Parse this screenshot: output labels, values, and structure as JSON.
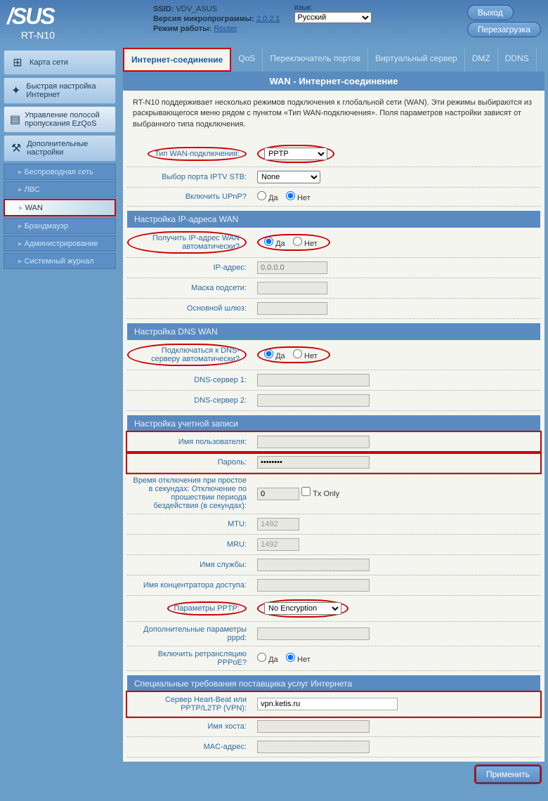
{
  "header": {
    "brand": "/SUS",
    "model": "RT-N10",
    "ssid_label": "SSID:",
    "ssid": "VDV_ASUS",
    "fw_label": "Версия микропрограммы:",
    "fw": "2.0.2.1",
    "mode_label": "Режим работы:",
    "mode": "Router",
    "lang_label": "язык:",
    "lang": "Русский",
    "logout": "Выход",
    "reboot": "Перезагрузка"
  },
  "sidebar": {
    "map": "Карта сети",
    "qis": "Быстрая настройка Интернет",
    "ezqos": "Управление полосой пропускания EzQoS",
    "adv": "Дополнительные настройки",
    "sub": [
      "Беспроводная сеть",
      "ЛВС",
      "WAN",
      "Брандмауэр",
      "Администрирование",
      "Системный журнал"
    ]
  },
  "tabs": [
    "Интернет-соединение",
    "QoS",
    "Переключатель портов",
    "Виртуальный сервер",
    "DMZ",
    "DDNS"
  ],
  "title": "WAN - Интернет-соединение",
  "desc": "RT-N10 поддерживает несколько режимов подключения к глобальной сети (WAN). Эти режимы выбираются из раскрывающегося меню рядом с пунктом «Тип WAN-подключения». Поля параметров настройки зависят от выбранного типа подключения.",
  "yes": "Да",
  "no": "Нет",
  "basic": {
    "wan_type_label": "Тип WAN-подключения:",
    "wan_type": "PPTP",
    "iptv_label": "Выбор порта IPTV STB:",
    "iptv": "None",
    "upnp_label": "Включить UPnP?"
  },
  "wanip": {
    "header": "Настройка IP-адреса WAN",
    "auto_label": "Получить IP-адрес WAN автоматически?",
    "ip_label": "IP-адрес:",
    "ip_ph": "0.0.0.0",
    "mask_label": "Маска подсети:",
    "gw_label": "Основной шлюз:"
  },
  "dns": {
    "header": "Настройка DNS WAN",
    "auto_label": "Подключаться к DNS-серверу автоматически?",
    "dns1_label": "DNS-сервер 1:",
    "dns2_label": "DNS-сервер 2:"
  },
  "acct": {
    "header": "Настройка учетной записи",
    "user_label": "Имя пользователя:",
    "pass_label": "Пароль:",
    "pass_val": "********",
    "idle_label": "Время отключения при простое в секундах: Отключение по прошествии периода бездействия (в секундах):",
    "idle_val": "0",
    "txonly": "Tx Only",
    "mtu_label": "MTU:",
    "mtu_val": "1492",
    "mru_label": "MRU:",
    "mru_val": "1492",
    "service_label": "Имя службы:",
    "ac_label": "Имя концентратора доступа:",
    "pptp_opt_label": "Параметры PPTP:",
    "pptp_opt": "No Encryption",
    "pppd_label": "Дополнительные параметры pppd:",
    "relay_label": "Включить ретрансляцию PPPoE?"
  },
  "isp": {
    "header": "Специальные требования поставщика услуг Интернета",
    "vpn_label": "Сервер Heart-Beat или PPTP/L2TP (VPN):",
    "vpn_val": "vpn.ketis.ru",
    "host_label": "Имя хоста:",
    "mac_label": "MAC-адрес:"
  },
  "apply": "Применить"
}
